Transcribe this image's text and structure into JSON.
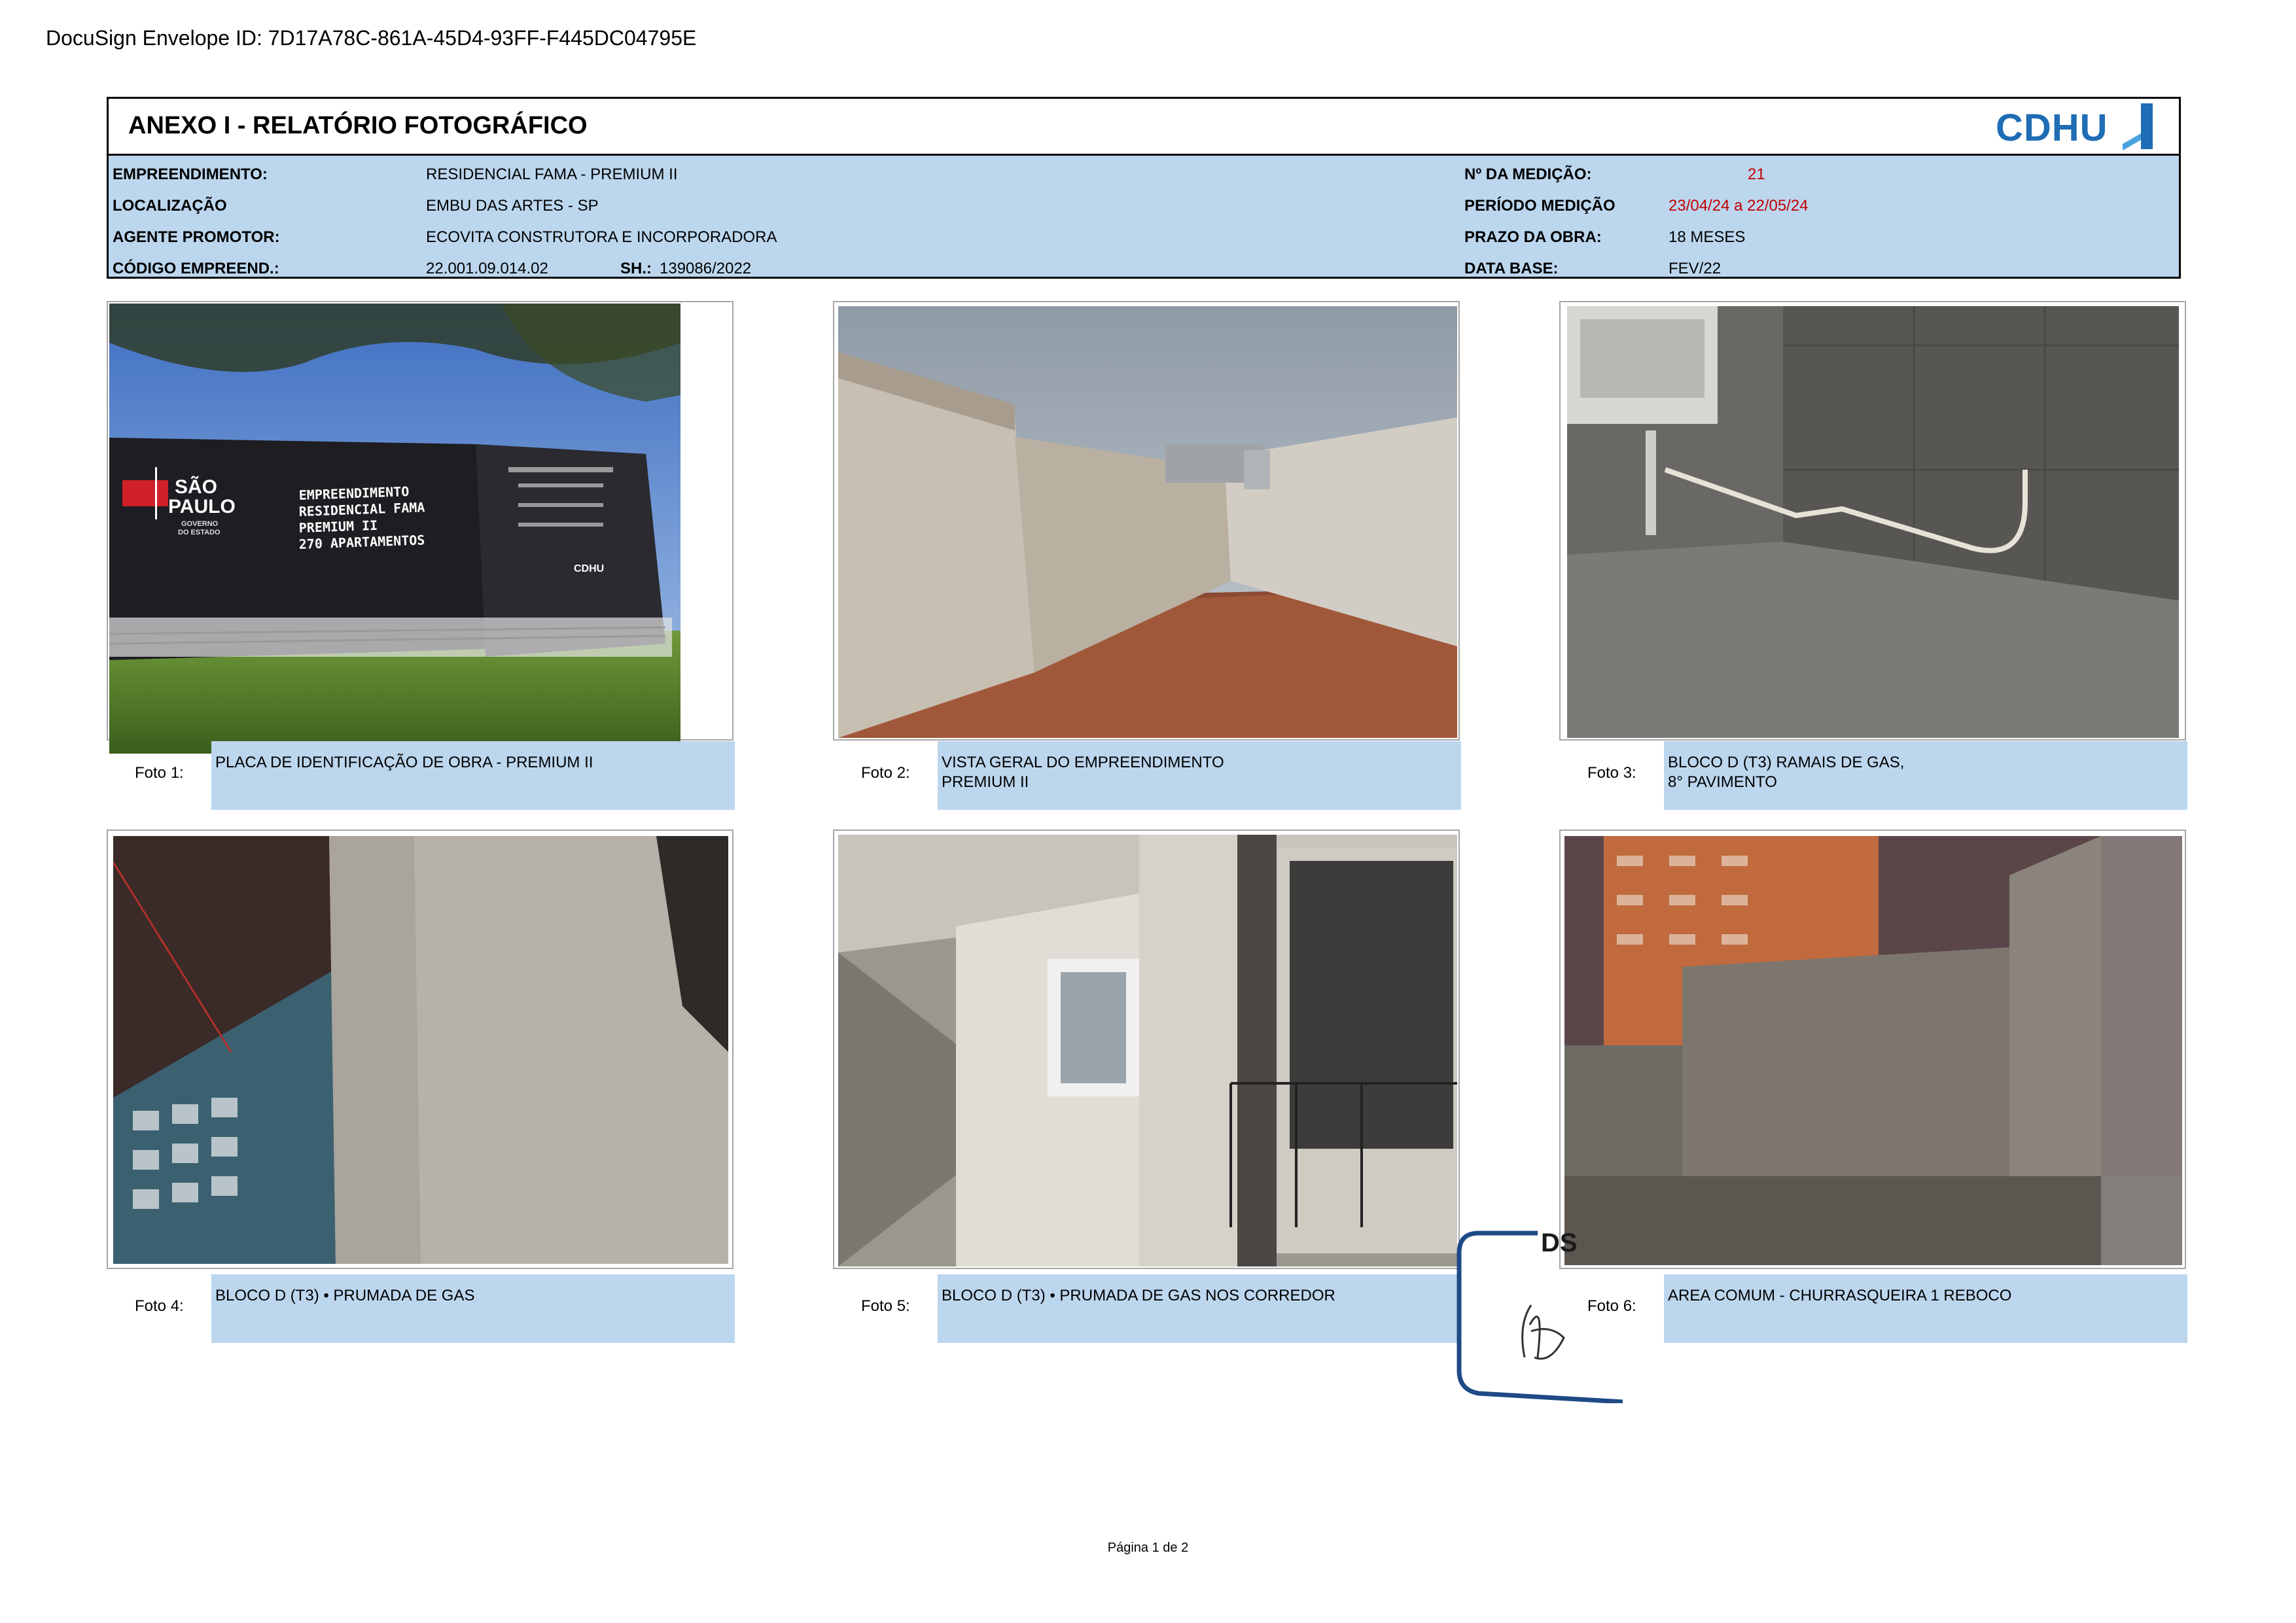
{
  "envelope_id": "DocuSign Envelope ID: 7D17A78C-861A-45D4-93FF-F445DC04795E",
  "header": {
    "title": "ANEXO I - RELATÓRIO FOTOGRÁFICO",
    "logo_text": "CDHU",
    "empreendimento_label": "EMPREENDIMENTO:",
    "empreendimento_value": "RESIDENCIAL FAMA - PREMIUM II",
    "localizacao_label": "LOCALIZAÇÃO",
    "localizacao_value": "EMBU DAS ARTES - SP",
    "agente_label": "AGENTE PROMOTOR:",
    "agente_value": "ECOVITA CONSTRUTORA E INCORPORADORA",
    "codigo_label": "CÓDIGO EMPREEND.:",
    "codigo_value": "22.001.09.014.02",
    "sh_label": "SH.:",
    "sh_value": "139086/2022",
    "medicao_label": "Nº DA MEDIÇÃO:",
    "medicao_value": "21",
    "periodo_label": "PERÍODO MEDIÇÃO",
    "periodo_value": "23/04/24 a 22/05/24",
    "prazo_label": "PRAZO DA OBRA:",
    "prazo_value": "18 MESES",
    "database_label": "DATA BASE:",
    "database_value": "FEV/22",
    "accent_red": "#c00000",
    "band_color": "#bcd6ee"
  },
  "photos": [
    {
      "num": "Foto 1:",
      "line1": "PLACA DE IDENTIFICAÇÃO DE OBRA - PREMIUM II",
      "line2": ""
    },
    {
      "num": "Foto 2:",
      "line1": "VISTA GERAL DO EMPREENDIMENTO",
      "line2": "PREMIUM II"
    },
    {
      "num": "Foto 3:",
      "line1": "BLOCO D (T3) RAMAIS DE GAS,",
      "line2": "8° PAVIMENTO"
    },
    {
      "num": "Foto 4:",
      "line1": "BLOCO D (T3) • PRUMADA DE GAS",
      "line2": ""
    },
    {
      "num": "Foto 5:",
      "line1": "BLOCO D (T3) • PRUMADA DE GAS NOS CORREDOR",
      "line2": ""
    },
    {
      "num": "Foto 6:",
      "line1": "AREA COMUM - CHURRASQUEIRA 1 REBOCO",
      "line2": ""
    }
  ],
  "sign_board": {
    "brand_line1": "SÃO",
    "brand_line2": "PAULO",
    "brand_line3": "GOVERNO",
    "brand_line4": "DO ESTADO",
    "text1": "EMPREENDIMENTO",
    "text2": "RESIDENCIAL FAMA",
    "text3": "PREMIUM II",
    "text4": "270 APARTAMENTOS",
    "side_logo": "CDHU"
  },
  "docusign_badge": "DS",
  "footer": "Página 1 de 2"
}
